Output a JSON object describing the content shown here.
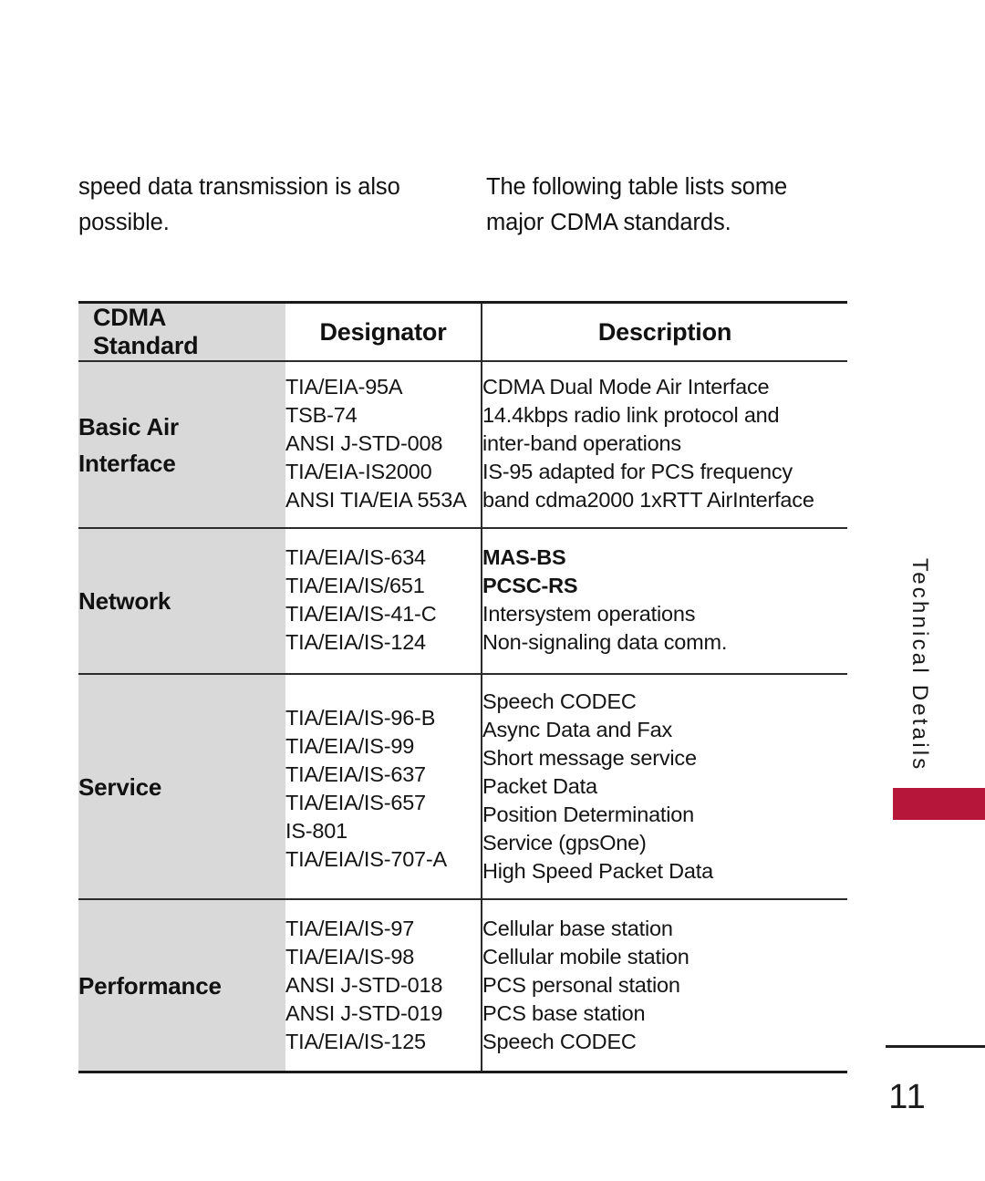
{
  "intro": {
    "left_column": "speed data transmission is also possible.",
    "right_column": "The following table lists some major CDMA standards."
  },
  "table": {
    "headers": {
      "category": "CDMA Standard",
      "designator": "Designator",
      "description": "Description"
    },
    "rows": [
      {
        "category": "Basic Air Interface",
        "category_line1": "Basic Air",
        "category_line2": "Interface",
        "designators": [
          "TIA/EIA-95A",
          "TSB-74",
          "ANSI J-STD-008",
          "TIA/EIA-IS2000",
          "ANSI TIA/EIA 553A"
        ],
        "descriptions": [
          "CDMA Dual Mode Air Interface",
          "14.4kbps radio link protocol and",
          "inter-band operations",
          "IS-95 adapted for PCS frequency",
          "band cdma2000 1xRTT AirInterface"
        ]
      },
      {
        "category": "Network",
        "designators": [
          "TIA/EIA/IS-634",
          "TIA/EIA/IS/651",
          "TIA/EIA/IS-41-C",
          "TIA/EIA/IS-124"
        ],
        "descriptions": [
          "MAS-BS",
          "PCSC-RS",
          "Intersystem operations",
          "Non-signaling data comm."
        ],
        "bold_description_lines": [
          0,
          1
        ]
      },
      {
        "category": "Service",
        "designators": [
          "TIA/EIA/IS-96-B",
          "TIA/EIA/IS-99",
          "TIA/EIA/IS-637",
          "TIA/EIA/IS-657",
          "IS-801",
          "TIA/EIA/IS-707-A"
        ],
        "descriptions": [
          "Speech CODEC",
          "Async Data and Fax",
          "Short message service",
          "Packet Data",
          "Position Determination",
          "Service (gpsOne)",
          "High Speed Packet Data"
        ]
      },
      {
        "category": "Performance",
        "designators": [
          "TIA/EIA/IS-97",
          "TIA/EIA/IS-98",
          "ANSI J-STD-018",
          "ANSI J-STD-019",
          "TIA/EIA/IS-125"
        ],
        "descriptions": [
          "Cellular base station",
          "Cellular mobile station",
          "PCS personal station",
          "PCS base station",
          "Speech CODEC"
        ]
      }
    ]
  },
  "side_tab": {
    "label": "Technical Details",
    "accent_color": "#b5163a"
  },
  "footer": {
    "page_number": "11"
  },
  "colors": {
    "shade": "#d9d9d9",
    "rule": "#1a1a1a",
    "text": "#141414",
    "accent": "#b5163a"
  }
}
